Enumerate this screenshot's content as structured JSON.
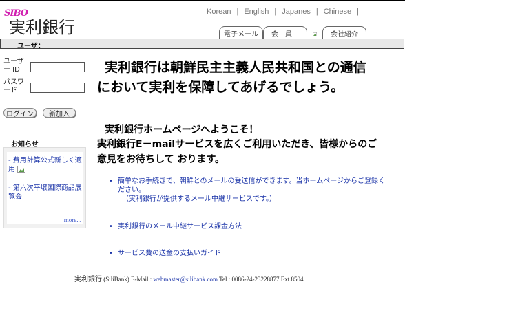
{
  "logo": {
    "sub": "SIBO",
    "title": "実利銀行"
  },
  "languages": [
    "Korean",
    "English",
    "Japanes",
    "Chinese"
  ],
  "tabs": {
    "mail": "電子メール",
    "member": "会員",
    "company": "会社紹介"
  },
  "userbar": {
    "label": "ユーザ："
  },
  "login": {
    "user_label": "ユーザー ID",
    "pass_label": "パスワード",
    "login_button": "ログイン",
    "signup_button": "新加入"
  },
  "notices": {
    "title": "お知らせ",
    "items": [
      "- 費用計算公式新しく適用",
      "- 第六次平壌国際商品展覧会"
    ],
    "more": "more..."
  },
  "main": {
    "headline_line1": "実利銀行は朝鮮民主主義人民共和国との通信",
    "headline_line2": "において実利を保障してあげるでしょう。",
    "welcome_line1": "実利銀行ホームページへようこそ！",
    "welcome_line2": "実利銀行E－mailサービスを広くご利用いただき、皆様からのご",
    "welcome_line3": "意見をお待ちして おります。"
  },
  "services": [
    {
      "line1": "簡単なお手続きで、朝鮮とのメールの受送信ができます。当ホームページからご登録く",
      "line2": "ださい。",
      "line3": "（実利銀行が提供するメール中継サービスです。）"
    },
    {
      "line1": "実利銀行のメール中継サービス課金方法"
    },
    {
      "line1": "サービス費の送金の支払いガイド"
    }
  ],
  "footer": {
    "name": "実利銀行",
    "prefix": " (SiliBank) E-Mail : ",
    "email": "webmaster@silibank.com",
    "tel": " Tel : 0086-24-23228877 Ext.8504"
  }
}
